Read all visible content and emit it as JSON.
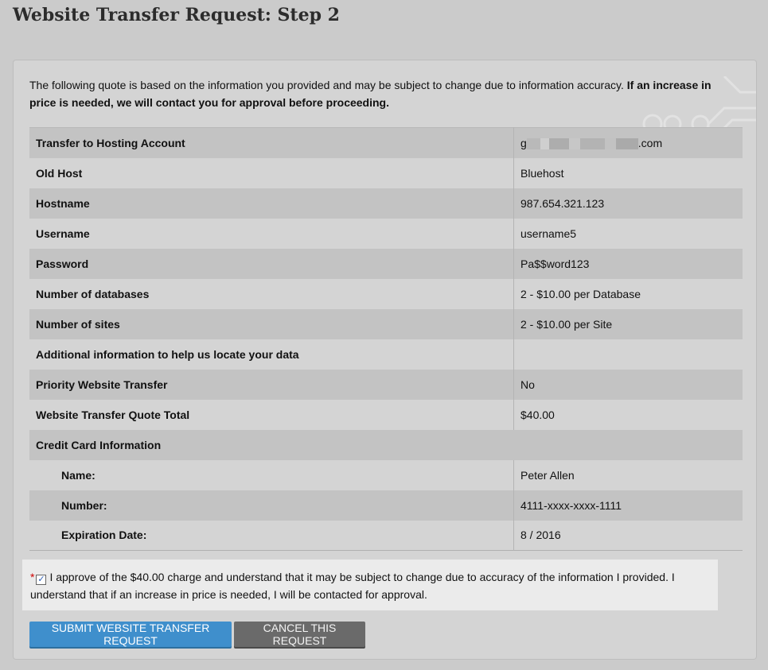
{
  "page": {
    "title": "Website Transfer Request: Step 2"
  },
  "intro": {
    "text": "The following quote is based on the information you provided and may be subject to change due to information accuracy.",
    "bold_text": "If an increase in price is needed, we will contact you for approval before proceeding."
  },
  "quote": {
    "rows": [
      {
        "label": "Transfer to Hosting Account",
        "value_prefix": "g",
        "value_suffix": ".com"
      },
      {
        "label": "Old Host",
        "value": "Bluehost"
      },
      {
        "label": "Hostname",
        "value": "987.654.321.123"
      },
      {
        "label": "Username",
        "value": "username5"
      },
      {
        "label": "Password",
        "value": "Pa$$word123"
      },
      {
        "label": "Number of databases",
        "value": "2 - $10.00 per Database"
      },
      {
        "label": "Number of sites",
        "value": "2 - $10.00 per Site"
      },
      {
        "label": "Additional information to help us locate your data",
        "value": ""
      },
      {
        "label": "Priority Website Transfer",
        "value": "No"
      },
      {
        "label": "Website Transfer Quote Total",
        "value": "$40.00"
      }
    ],
    "credit_card": {
      "heading": "Credit Card Information",
      "name_label": "Name:",
      "name_value": "Peter Allen",
      "number_label": "Number:",
      "number_value": "4111-xxxx-xxxx-1111",
      "exp_label": "Expiration Date:",
      "exp_value": "8 / 2016"
    }
  },
  "approval": {
    "required_mark": "*",
    "checked": true,
    "text": "I approve of the $40.00 charge and understand that it may be subject to change due to accuracy of the information I provided. I understand that if an increase in price is needed, I will be contacted for approval."
  },
  "buttons": {
    "submit": "SUBMIT WEBSITE TRANSFER REQUEST",
    "cancel": "CANCEL THIS REQUEST"
  },
  "colors": {
    "submit": "#3f8fcc",
    "cancel": "#6a6a6a",
    "required": "#cc0000"
  }
}
